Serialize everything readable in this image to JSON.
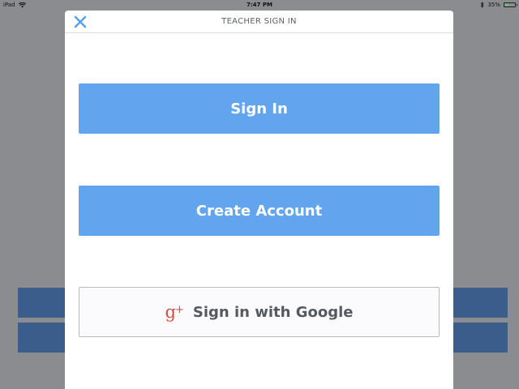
{
  "status_bar": {
    "device": "iPad",
    "time": "7:47 PM",
    "battery_text": "35%",
    "battery_level": 0.35,
    "icons": [
      "wifi-icon",
      "bluetooth-icon",
      "battery-icon"
    ]
  },
  "modal": {
    "title": "TEACHER SIGN IN",
    "close_icon": "close-icon"
  },
  "buttons": {
    "sign_in": "Sign In",
    "create_account": "Create Account",
    "google": "Sign in with Google",
    "google_icon": "google-plus-icon"
  },
  "colors": {
    "primary_button": "#62a5ee",
    "close_icon": "#5aa3e8",
    "google_red": "#d54b3d",
    "background_bars": "#3a5d8c"
  }
}
